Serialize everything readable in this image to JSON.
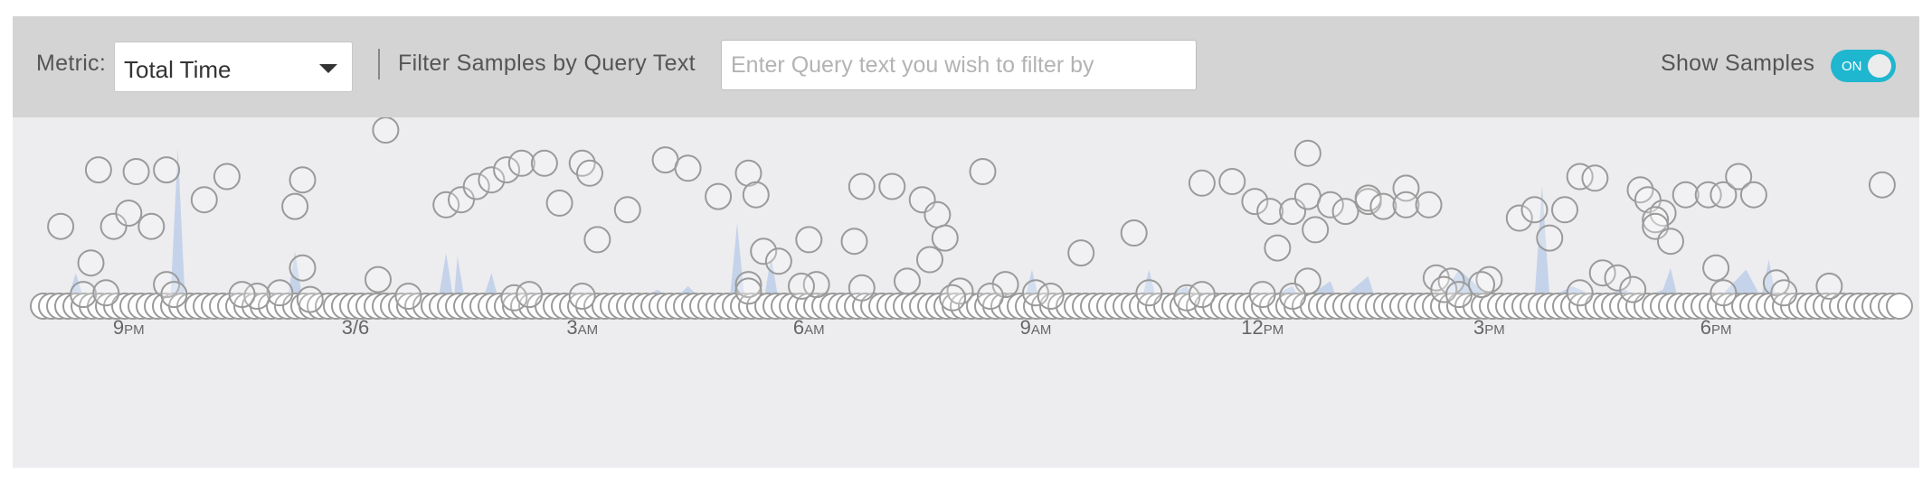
{
  "toolbar": {
    "metric_label": "Metric:",
    "metric_value": "Total Time",
    "filter_label": "Filter Samples by Query Text",
    "filter_placeholder": "Enter Query text you wish to filter by",
    "filter_value": "",
    "show_samples_label": "Show Samples",
    "show_samples_state": "ON"
  },
  "colors": {
    "accent": "#1fb6cf",
    "area_fill": "#c5d3ea",
    "sample_stroke": "#9a9a9a",
    "toolbar_bg": "#d4d4d4",
    "chart_bg": "#ededef"
  },
  "chart_data": {
    "type": "scatter",
    "x_ticks": [
      {
        "big": "9",
        "small": "PM"
      },
      {
        "big": "3/6",
        "small": ""
      },
      {
        "big": "3",
        "small": "AM"
      },
      {
        "big": "6",
        "small": "AM"
      },
      {
        "big": "9",
        "small": "AM"
      },
      {
        "big": "12",
        "small": "PM"
      },
      {
        "big": "3",
        "small": "PM"
      },
      {
        "big": "6",
        "small": "PM"
      }
    ],
    "x_tick_hours": [
      21,
      24,
      27,
      30,
      33,
      36,
      39,
      42
    ],
    "xlim": [
      19.8,
      44.5
    ],
    "ylim": [
      0,
      100
    ],
    "area_series": [
      [
        19.8,
        0
      ],
      [
        20.2,
        5
      ],
      [
        20.3,
        20
      ],
      [
        20.4,
        5
      ],
      [
        20.9,
        3
      ],
      [
        21.2,
        6
      ],
      [
        21.55,
        1
      ],
      [
        21.65,
        95
      ],
      [
        21.75,
        1
      ],
      [
        22.1,
        3
      ],
      [
        22.5,
        6
      ],
      [
        22.8,
        3
      ],
      [
        23.1,
        4
      ],
      [
        23.2,
        33
      ],
      [
        23.3,
        4
      ],
      [
        23.7,
        3
      ],
      [
        24.1,
        4
      ],
      [
        24.3,
        5
      ],
      [
        24.7,
        3
      ],
      [
        25.1,
        5
      ],
      [
        25.2,
        32
      ],
      [
        25.3,
        3
      ],
      [
        25.35,
        30
      ],
      [
        25.45,
        3
      ],
      [
        25.7,
        6
      ],
      [
        25.8,
        20
      ],
      [
        25.9,
        3
      ],
      [
        26.3,
        4
      ],
      [
        26.6,
        5
      ],
      [
        26.7,
        3
      ],
      [
        27.3,
        5
      ],
      [
        27.7,
        3
      ],
      [
        28.0,
        10
      ],
      [
        28.2,
        3
      ],
      [
        28.4,
        12
      ],
      [
        28.6,
        3
      ],
      [
        28.95,
        3
      ],
      [
        29.05,
        50
      ],
      [
        29.15,
        3
      ],
      [
        29.4,
        3
      ],
      [
        29.5,
        30
      ],
      [
        29.6,
        3
      ],
      [
        30.1,
        4
      ],
      [
        30.6,
        5
      ],
      [
        31.1,
        3
      ],
      [
        31.5,
        6
      ],
      [
        32.0,
        4
      ],
      [
        32.5,
        5
      ],
      [
        32.85,
        3
      ],
      [
        32.95,
        22
      ],
      [
        33.05,
        3
      ],
      [
        33.5,
        5
      ],
      [
        34.0,
        4
      ],
      [
        34.4,
        3
      ],
      [
        34.5,
        22
      ],
      [
        34.6,
        3
      ],
      [
        35.0,
        12
      ],
      [
        35.1,
        3
      ],
      [
        35.5,
        5
      ],
      [
        36.0,
        4
      ],
      [
        36.4,
        12
      ],
      [
        36.5,
        3
      ],
      [
        36.9,
        15
      ],
      [
        37.0,
        3
      ],
      [
        37.4,
        18
      ],
      [
        37.5,
        3
      ],
      [
        38.0,
        8
      ],
      [
        38.4,
        8
      ],
      [
        38.6,
        22
      ],
      [
        38.8,
        14
      ],
      [
        39.0,
        4
      ],
      [
        39.3,
        6
      ],
      [
        39.6,
        4
      ],
      [
        39.7,
        73
      ],
      [
        39.8,
        5
      ],
      [
        40.1,
        12
      ],
      [
        40.4,
        6
      ],
      [
        40.8,
        10
      ],
      [
        41.0,
        4
      ],
      [
        41.3,
        10
      ],
      [
        41.4,
        23
      ],
      [
        41.5,
        4
      ],
      [
        41.9,
        8
      ],
      [
        42.0,
        3
      ],
      [
        42.4,
        22
      ],
      [
        42.6,
        5
      ],
      [
        42.7,
        28
      ],
      [
        42.8,
        4
      ],
      [
        43.2,
        6
      ],
      [
        43.6,
        3
      ],
      [
        44.0,
        5
      ],
      [
        44.5,
        2
      ]
    ],
    "samples": [
      [
        20.6,
        82
      ],
      [
        20.1,
        48
      ],
      [
        20.5,
        26
      ],
      [
        20.8,
        48
      ],
      [
        21.0,
        56
      ],
      [
        21.3,
        48
      ],
      [
        21.1,
        81
      ],
      [
        21.5,
        82
      ],
      [
        22.0,
        64
      ],
      [
        22.3,
        78
      ],
      [
        21.5,
        13
      ],
      [
        20.4,
        7
      ],
      [
        20.7,
        8
      ],
      [
        21.6,
        7
      ],
      [
        23.2,
        60
      ],
      [
        23.3,
        76
      ],
      [
        23.3,
        23
      ],
      [
        23.0,
        8
      ],
      [
        23.4,
        4
      ],
      [
        22.7,
        6
      ],
      [
        22.5,
        7
      ],
      [
        24.3,
        16
      ],
      [
        24.4,
        106
      ],
      [
        24.7,
        6
      ],
      [
        25.2,
        61
      ],
      [
        25.4,
        64
      ],
      [
        25.6,
        72
      ],
      [
        25.8,
        76
      ],
      [
        26.0,
        82
      ],
      [
        26.2,
        86
      ],
      [
        26.5,
        86
      ],
      [
        26.7,
        62
      ],
      [
        27.0,
        86
      ],
      [
        27.1,
        80
      ],
      [
        27.2,
        40
      ],
      [
        27.6,
        58
      ],
      [
        28.1,
        88
      ],
      [
        28.4,
        83
      ],
      [
        28.8,
        66
      ],
      [
        29.2,
        80
      ],
      [
        29.3,
        67
      ],
      [
        29.4,
        33
      ],
      [
        29.6,
        27
      ],
      [
        30.0,
        40
      ],
      [
        30.7,
        72
      ],
      [
        31.1,
        72
      ],
      [
        30.6,
        39
      ],
      [
        30.1,
        13
      ],
      [
        29.2,
        13
      ],
      [
        29.2,
        9
      ],
      [
        29.9,
        12
      ],
      [
        31.5,
        64
      ],
      [
        31.7,
        55
      ],
      [
        31.8,
        41
      ],
      [
        31.6,
        28
      ],
      [
        32.3,
        81
      ],
      [
        31.3,
        15
      ],
      [
        32.6,
        13
      ],
      [
        30.7,
        11
      ],
      [
        33.6,
        32
      ],
      [
        34.3,
        44
      ],
      [
        35.2,
        74
      ],
      [
        35.6,
        75
      ],
      [
        35.9,
        63
      ],
      [
        36.1,
        57
      ],
      [
        36.2,
        35
      ],
      [
        36.4,
        57
      ],
      [
        36.6,
        92
      ],
      [
        36.6,
        66
      ],
      [
        36.7,
        46
      ],
      [
        36.9,
        61
      ],
      [
        37.1,
        57
      ],
      [
        37.4,
        63
      ],
      [
        37.4,
        65
      ],
      [
        37.6,
        60
      ],
      [
        37.9,
        71
      ],
      [
        37.9,
        61
      ],
      [
        38.2,
        61
      ],
      [
        36.6,
        15
      ],
      [
        36.4,
        6
      ],
      [
        36.0,
        7
      ],
      [
        38.3,
        17
      ],
      [
        38.5,
        15
      ],
      [
        38.4,
        10
      ],
      [
        38.6,
        7
      ],
      [
        39.4,
        53
      ],
      [
        39.6,
        58
      ],
      [
        39.8,
        41
      ],
      [
        40.0,
        58
      ],
      [
        40.2,
        78
      ],
      [
        40.4,
        77
      ],
      [
        41.0,
        70
      ],
      [
        41.1,
        64
      ],
      [
        41.3,
        56
      ],
      [
        41.2,
        52
      ],
      [
        41.2,
        48
      ],
      [
        41.4,
        39
      ],
      [
        41.6,
        67
      ],
      [
        41.9,
        67
      ],
      [
        42.1,
        67
      ],
      [
        42.3,
        78
      ],
      [
        42.5,
        67
      ],
      [
        40.5,
        20
      ],
      [
        40.7,
        17
      ],
      [
        40.9,
        10
      ],
      [
        42.0,
        23
      ],
      [
        42.1,
        8
      ],
      [
        42.8,
        14
      ],
      [
        44.2,
        73
      ],
      [
        40.2,
        8
      ],
      [
        42.9,
        8
      ],
      [
        43.5,
        12
      ],
      [
        39.0,
        16
      ],
      [
        38.9,
        13
      ],
      [
        26.1,
        5
      ],
      [
        26.3,
        7
      ],
      [
        27.0,
        6
      ],
      [
        33.0,
        8
      ],
      [
        33.2,
        6
      ],
      [
        34.5,
        8
      ],
      [
        35.0,
        5
      ],
      [
        35.2,
        7
      ],
      [
        32.0,
        9
      ],
      [
        32.4,
        6
      ],
      [
        31.9,
        5
      ]
    ]
  }
}
